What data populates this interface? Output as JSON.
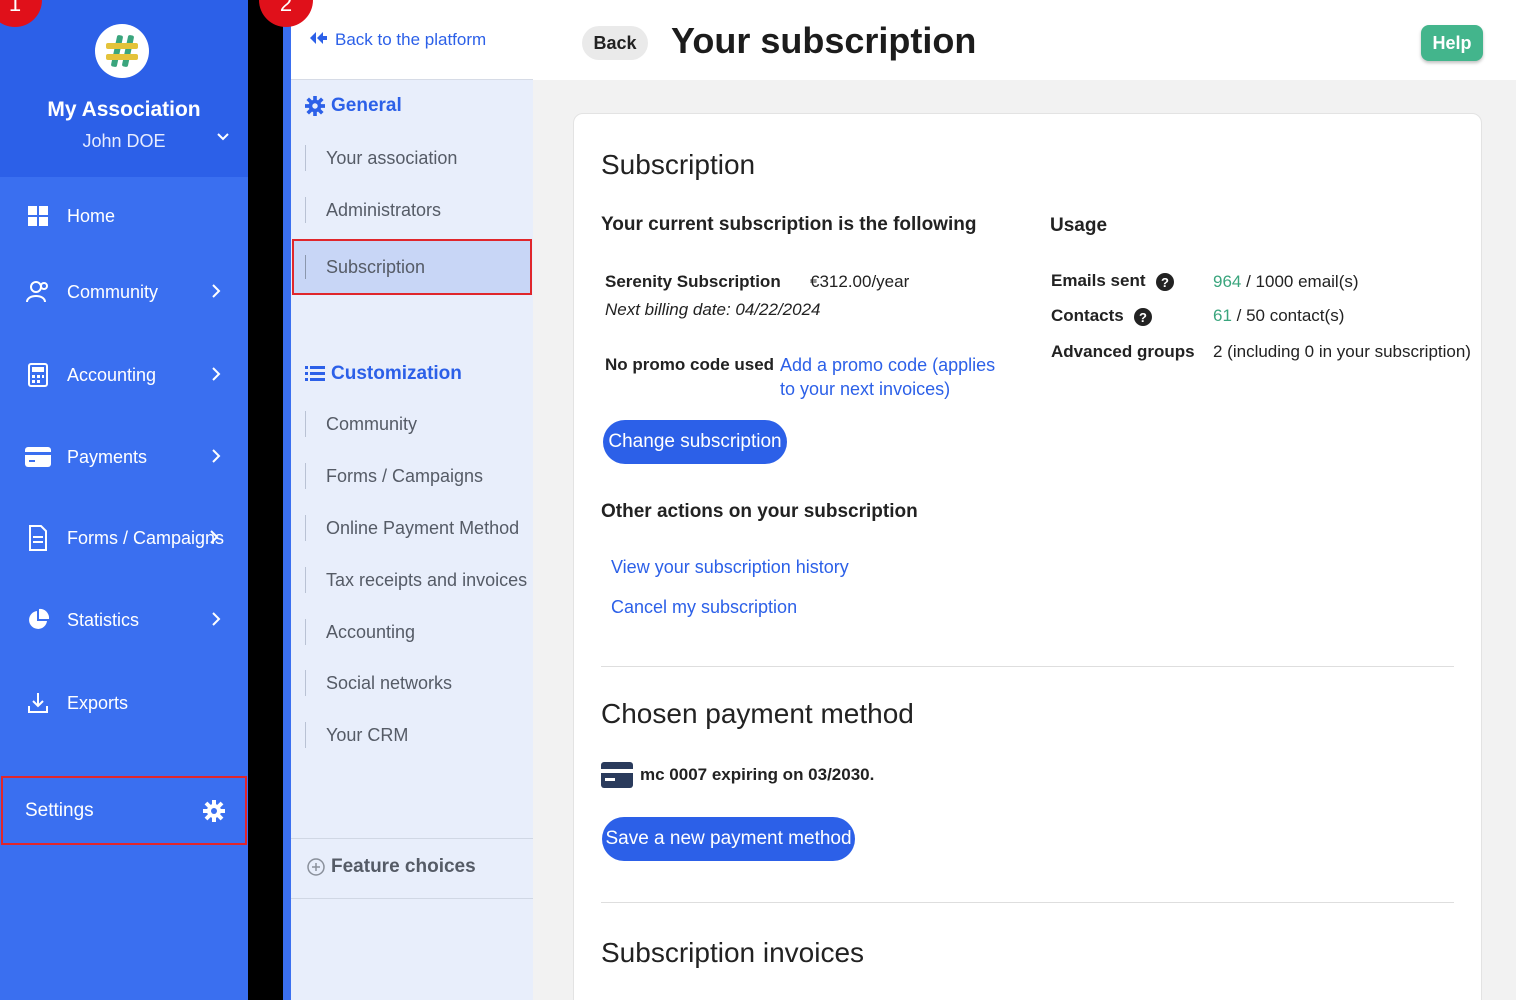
{
  "sidebar": {
    "org_name": "My Association",
    "user_name": "John DOE",
    "items": [
      {
        "label": "Home",
        "icon": "grid-icon"
      },
      {
        "label": "Community",
        "icon": "users-icon"
      },
      {
        "label": "Accounting",
        "icon": "calculator-icon"
      },
      {
        "label": "Payments",
        "icon": "credit-card-icon"
      },
      {
        "label": "Forms / Campaigns",
        "icon": "document-icon"
      },
      {
        "label": "Statistics",
        "icon": "pie-chart-icon"
      },
      {
        "label": "Exports",
        "icon": "download-icon"
      }
    ],
    "settings_label": "Settings"
  },
  "badges": {
    "first": "1",
    "second": "2"
  },
  "subnav": {
    "back_label": "Back to the platform",
    "general_title": "General",
    "general_items": [
      "Your association",
      "Administrators",
      "Subscription"
    ],
    "customization_title": "Customization",
    "customization_items": [
      "Community",
      "Forms / Campaigns",
      "Online Payment Method",
      "Tax receipts and invoices",
      "Accounting",
      "Social networks",
      "Your CRM"
    ],
    "feature_label": "Feature choices"
  },
  "header": {
    "back_label": "Back",
    "title": "Your subscription",
    "help_label": "Help"
  },
  "subscription": {
    "section_title": "Subscription",
    "current_title": "Your current subscription is the following",
    "plan_name": "Serenity Subscription",
    "plan_price": "€312.00/year",
    "next_billing": "Next billing date: 04/22/2024",
    "promo_label": "No promo code used",
    "promo_link_line1": "Add a promo code (applies",
    "promo_link_line2": "to your next invoices)",
    "change_button": "Change subscription",
    "other_actions_title": "Other actions on your subscription",
    "history_link": "View your subscription history",
    "cancel_link": "Cancel my subscription"
  },
  "usage": {
    "title": "Usage",
    "emails_label": "Emails sent",
    "emails_used": "964",
    "emails_total": " / 1000 email(s)",
    "contacts_label": "Contacts",
    "contacts_used": "61",
    "contacts_total": " / 50 contact(s)",
    "groups_label": "Advanced groups",
    "groups_value": "2 (including 0 in your subscription)"
  },
  "payment": {
    "section_title": "Chosen payment method",
    "card_text": "mc 0007 expiring on 03/2030.",
    "save_button": "Save a new payment method"
  },
  "invoices": {
    "section_title": "Subscription invoices"
  },
  "colors": {
    "primary": "#2c60e8",
    "sidebar": "#3a6ff0",
    "help": "#43b58c",
    "highlight": "#e0262b"
  }
}
